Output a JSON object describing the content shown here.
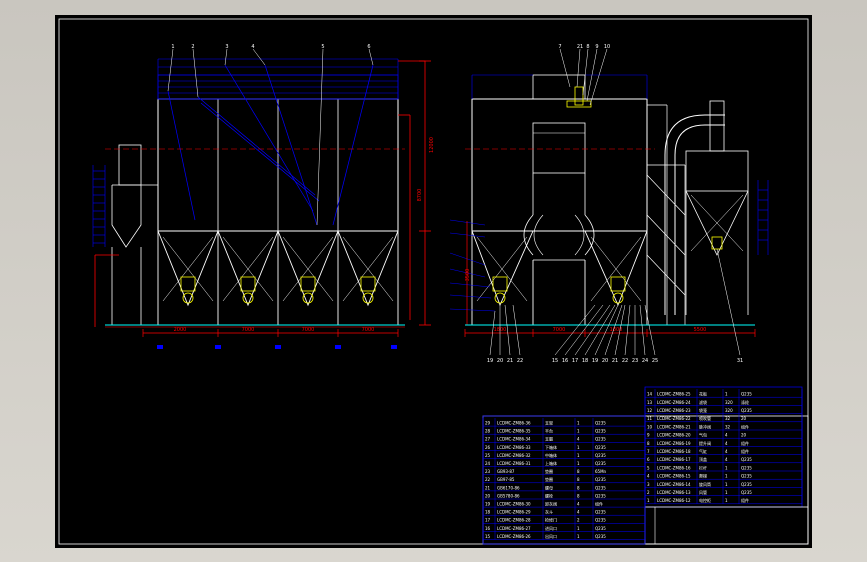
{
  "title_block": {
    "parts_left": [
      {
        "no": "29",
        "code": "LCDMC-ZM86-36",
        "name": "支架",
        "qty": "1",
        "mat": "Q235"
      },
      {
        "no": "28",
        "code": "LCDMC-ZM86-35",
        "name": "平台",
        "qty": "1",
        "mat": "Q235"
      },
      {
        "no": "27",
        "code": "LCDMC-ZM86-34",
        "name": "支腿",
        "qty": "4",
        "mat": "Q235"
      },
      {
        "no": "26",
        "code": "LCDMC-ZM86-33",
        "name": "下箱体",
        "qty": "1",
        "mat": "Q235"
      },
      {
        "no": "25",
        "code": "LCDMC-ZM86-32",
        "name": "中箱体",
        "qty": "1",
        "mat": "Q235"
      },
      {
        "no": "24",
        "code": "LCDMC-ZM86-31",
        "name": "上箱体",
        "qty": "1",
        "mat": "Q235"
      },
      {
        "no": "23",
        "code": "GB93-87",
        "name": "垫圈",
        "qty": "8",
        "mat": "65Mn"
      },
      {
        "no": "22",
        "code": "GB97-85",
        "name": "垫圈",
        "qty": "8",
        "mat": "Q235"
      },
      {
        "no": "21",
        "code": "GB6170-86",
        "name": "螺母",
        "qty": "8",
        "mat": "Q235"
      },
      {
        "no": "20",
        "code": "GB5780-86",
        "name": "螺栓",
        "qty": "8",
        "mat": "Q235"
      },
      {
        "no": "19",
        "code": "LCDMC-ZM86-30",
        "name": "卸灰阀",
        "qty": "4",
        "mat": "组件"
      },
      {
        "no": "18",
        "code": "LCDMC-ZM86-29",
        "name": "灰斗",
        "qty": "4",
        "mat": "Q235"
      },
      {
        "no": "17",
        "code": "LCDMC-ZM86-28",
        "name": "检修门",
        "qty": "2",
        "mat": "Q235"
      },
      {
        "no": "16",
        "code": "LCDMC-ZM86-27",
        "name": "进风口",
        "qty": "1",
        "mat": "Q235"
      },
      {
        "no": "15",
        "code": "LCDMC-ZM86-26",
        "name": "出风口",
        "qty": "1",
        "mat": "Q235"
      }
    ],
    "parts_right": [
      {
        "no": "14",
        "code": "LCDMC-ZM86-25",
        "name": "花板",
        "qty": "1",
        "mat": "Q235"
      },
      {
        "no": "13",
        "code": "LCDMC-ZM86-24",
        "name": "滤袋",
        "qty": "320",
        "mat": "涤纶"
      },
      {
        "no": "12",
        "code": "LCDMC-ZM86-23",
        "name": "袋笼",
        "qty": "320",
        "mat": "Q235"
      },
      {
        "no": "11",
        "code": "LCDMC-ZM86-22",
        "name": "喷吹管",
        "qty": "32",
        "mat": "20"
      },
      {
        "no": "10",
        "code": "LCDMC-ZM86-21",
        "name": "脉冲阀",
        "qty": "32",
        "mat": "组件"
      },
      {
        "no": "9",
        "code": "LCDMC-ZM86-20",
        "name": "气包",
        "qty": "4",
        "mat": "20"
      },
      {
        "no": "8",
        "code": "LCDMC-ZM86-19",
        "name": "提升阀",
        "qty": "4",
        "mat": "组件"
      },
      {
        "no": "7",
        "code": "LCDMC-ZM86-18",
        "name": "气缸",
        "qty": "4",
        "mat": "组件"
      },
      {
        "no": "6",
        "code": "LCDMC-ZM86-17",
        "name": "顶盖",
        "qty": "4",
        "mat": "Q235"
      },
      {
        "no": "5",
        "code": "LCDMC-ZM86-16",
        "name": "栏杆",
        "qty": "1",
        "mat": "Q235"
      },
      {
        "no": "4",
        "code": "LCDMC-ZM86-15",
        "name": "爬梯",
        "qty": "1",
        "mat": "Q235"
      },
      {
        "no": "3",
        "code": "LCDMC-ZM86-14",
        "name": "旋风筒",
        "qty": "1",
        "mat": "Q235"
      },
      {
        "no": "2",
        "code": "LCDMC-ZM86-13",
        "name": "风管",
        "qty": "1",
        "mat": "Q235"
      },
      {
        "no": "1",
        "code": "LCDMC-ZM86-12",
        "name": "电控柜",
        "qty": "1",
        "mat": "组件"
      }
    ]
  },
  "dims": {
    "d1": "2000",
    "d2": "7000",
    "d3": "7000",
    "d4": "7000",
    "d5": "1800",
    "d6": "7000",
    "d7": "1800",
    "d8": "8700",
    "d9": "12000",
    "d10": "5500",
    "d11": "3500"
  },
  "balloons_top_left": [
    "1",
    "2",
    "3",
    "4",
    "5",
    "6"
  ],
  "balloons_top_right": [
    "7",
    "21",
    "8",
    "9",
    "10"
  ],
  "balloons_bottom_right": [
    "19",
    "20",
    "21",
    "22",
    "15",
    "16",
    "17",
    "18",
    "19",
    "20",
    "21",
    "22",
    "23",
    "24",
    "25"
  ],
  "balloon_far_right": "31",
  "colors": {
    "background": "#000000",
    "outline": "#ffffff",
    "dimension": "#ff0000",
    "leader": "#0000ff",
    "accent": "#ffff00",
    "ground": "#00ffff"
  }
}
